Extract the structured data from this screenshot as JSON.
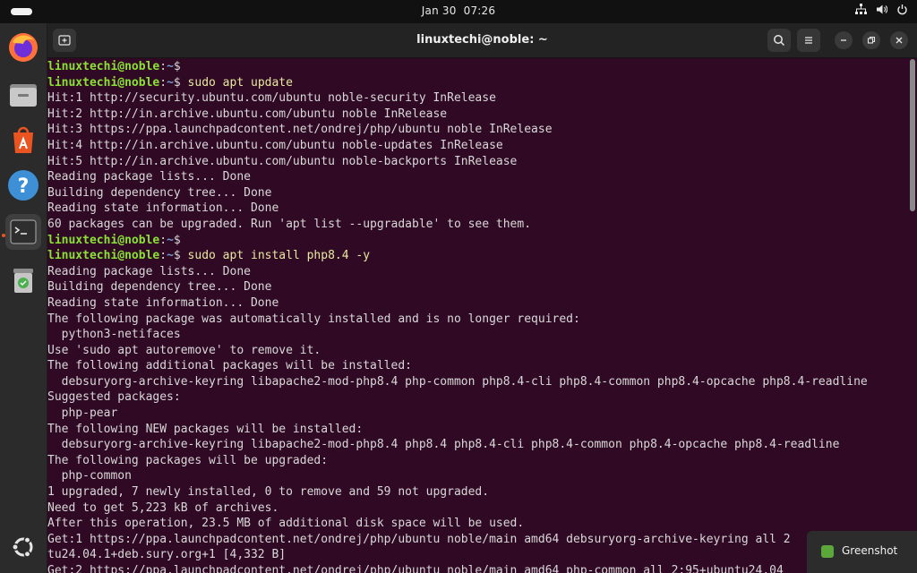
{
  "topbar": {
    "date": "Jan 30",
    "time": "07:26",
    "icons": [
      "network-icon",
      "volume-icon",
      "power-icon"
    ]
  },
  "dock": {
    "items": [
      {
        "name": "firefox",
        "icon": "firefox-icon"
      },
      {
        "name": "files",
        "icon": "folder-icon"
      },
      {
        "name": "app-center",
        "icon": "store-icon"
      },
      {
        "name": "help",
        "icon": "help-icon"
      },
      {
        "name": "terminal",
        "icon": "terminal-icon",
        "active": true
      },
      {
        "name": "trash",
        "icon": "trash-icon"
      }
    ],
    "show_apps_icon": "ubuntu-logo-icon"
  },
  "window": {
    "title": "linuxtechi@noble: ~",
    "new_tab_icon": "new-tab-icon",
    "search_icon": "search-icon",
    "menu_icon": "hamburger-icon",
    "controls": [
      "minimize-icon",
      "restore-icon",
      "close-icon"
    ]
  },
  "terminal": {
    "prompt_user": "linuxtechi@noble",
    "prompt_sep": ":",
    "prompt_path": "~",
    "prompt_end": "$ ",
    "lines": [
      {
        "type": "prompt",
        "cmd": ""
      },
      {
        "type": "prompt",
        "cmd": "sudo apt update"
      },
      {
        "type": "out",
        "text": "Hit:1 http://security.ubuntu.com/ubuntu noble-security InRelease"
      },
      {
        "type": "out",
        "text": "Hit:2 http://in.archive.ubuntu.com/ubuntu noble InRelease"
      },
      {
        "type": "out",
        "text": "Hit:3 https://ppa.launchpadcontent.net/ondrej/php/ubuntu noble InRelease"
      },
      {
        "type": "out",
        "text": "Hit:4 http://in.archive.ubuntu.com/ubuntu noble-updates InRelease"
      },
      {
        "type": "out",
        "text": "Hit:5 http://in.archive.ubuntu.com/ubuntu noble-backports InRelease"
      },
      {
        "type": "out",
        "text": "Reading package lists... Done"
      },
      {
        "type": "out",
        "text": "Building dependency tree... Done"
      },
      {
        "type": "out",
        "text": "Reading state information... Done"
      },
      {
        "type": "out",
        "text": "60 packages can be upgraded. Run 'apt list --upgradable' to see them."
      },
      {
        "type": "prompt",
        "cmd": ""
      },
      {
        "type": "prompt",
        "cmd": "sudo apt install php8.4 -y"
      },
      {
        "type": "out",
        "text": "Reading package lists... Done"
      },
      {
        "type": "out",
        "text": "Building dependency tree... Done"
      },
      {
        "type": "out",
        "text": "Reading state information... Done"
      },
      {
        "type": "out",
        "text": "The following package was automatically installed and is no longer required:"
      },
      {
        "type": "out",
        "text": "  python3-netifaces"
      },
      {
        "type": "out",
        "text": "Use 'sudo apt autoremove' to remove it."
      },
      {
        "type": "out",
        "text": "The following additional packages will be installed:"
      },
      {
        "type": "out",
        "text": "  debsuryorg-archive-keyring libapache2-mod-php8.4 php-common php8.4-cli php8.4-common php8.4-opcache php8.4-readline"
      },
      {
        "type": "out",
        "text": "Suggested packages:"
      },
      {
        "type": "out",
        "text": "  php-pear"
      },
      {
        "type": "out",
        "text": "The following NEW packages will be installed:"
      },
      {
        "type": "out",
        "text": "  debsuryorg-archive-keyring libapache2-mod-php8.4 php8.4 php8.4-cli php8.4-common php8.4-opcache php8.4-readline"
      },
      {
        "type": "out",
        "text": "The following packages will be upgraded:"
      },
      {
        "type": "out",
        "text": "  php-common"
      },
      {
        "type": "out",
        "text": "1 upgraded, 7 newly installed, 0 to remove and 59 not upgraded."
      },
      {
        "type": "out",
        "text": "Need to get 5,223 kB of archives."
      },
      {
        "type": "out",
        "text": "After this operation, 23.5 MB of additional disk space will be used."
      },
      {
        "type": "out",
        "text": "Get:1 https://ppa.launchpadcontent.net/ondrej/php/ubuntu noble/main amd64 debsuryorg-archive-keyring all 2"
      },
      {
        "type": "out",
        "text": "tu24.04.1+deb.sury.org+1 [4,332 B]"
      },
      {
        "type": "out",
        "text": "Get:2 https://ppa.launchpadcontent.net/ondrej/php/ubuntu noble/main amd64 php-common all 2:95+ubuntu24.04"
      }
    ]
  },
  "notification": {
    "label": "Greenshot",
    "icon": "greenshot-icon"
  },
  "colors": {
    "terminal_bg": "#300a24",
    "prompt_user": "#8ae234",
    "prompt_path": "#729fcf",
    "accent": "#e95420"
  }
}
